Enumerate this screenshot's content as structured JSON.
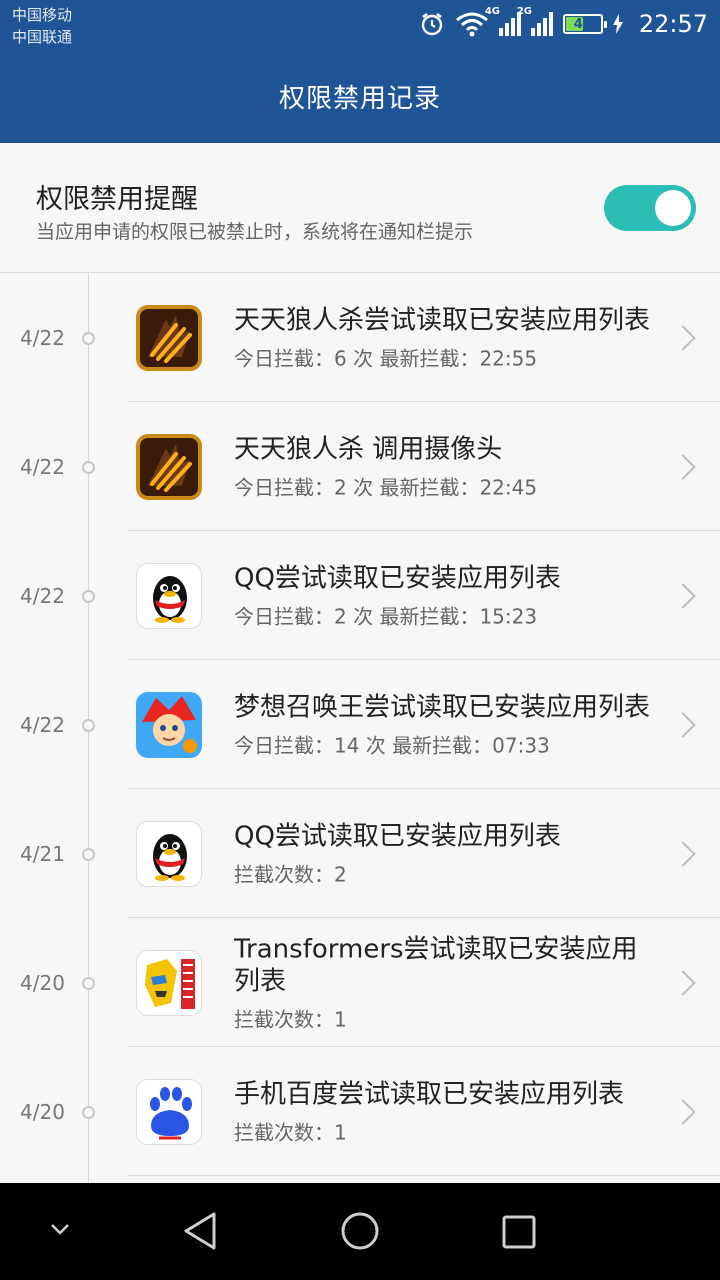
{
  "status_bar": {
    "carrier1": "中国移动",
    "carrier2": "中国联通",
    "network1": "4G",
    "network2": "2G",
    "battery": "48",
    "time": "22:57"
  },
  "header": {
    "title": "权限禁用记录"
  },
  "toggle": {
    "title": "权限禁用提醒",
    "desc": "当应用申请的权限已被禁止时，系统将在通知栏提示",
    "enabled": true
  },
  "items": [
    {
      "date": "4/22",
      "title": "天天狼人杀尝试读取已安装应用列表",
      "sub": "今日拦截：6 次    最新拦截：22:55",
      "icon": "werewolf-app-icon"
    },
    {
      "date": "4/22",
      "title": "天天狼人杀 调用摄像头",
      "sub": "今日拦截：2 次    最新拦截：22:45",
      "icon": "werewolf-app-icon"
    },
    {
      "date": "4/22",
      "title": "QQ尝试读取已安装应用列表",
      "sub": "今日拦截：2 次    最新拦截：15:23",
      "icon": "qq-penguin-icon"
    },
    {
      "date": "4/22",
      "title": "梦想召唤王尝试读取已安装应用列表",
      "sub": "今日拦截：14 次    最新拦截：07:33",
      "icon": "dream-summoner-app-icon"
    },
    {
      "date": "4/21",
      "title": "QQ尝试读取已安装应用列表",
      "sub": "拦截次数：2",
      "icon": "qq-penguin-icon"
    },
    {
      "date": "4/20",
      "title": "Transformers尝试读取已安装应用列表",
      "sub": "拦截次数：1",
      "icon": "transformers-app-icon"
    },
    {
      "date": "4/20",
      "title": "手机百度尝试读取已安装应用列表",
      "sub": "拦截次数：1",
      "icon": "baidu-paw-icon"
    }
  ],
  "colors": {
    "header": "#1f5597",
    "toggle_on": "#2bbcb6"
  }
}
